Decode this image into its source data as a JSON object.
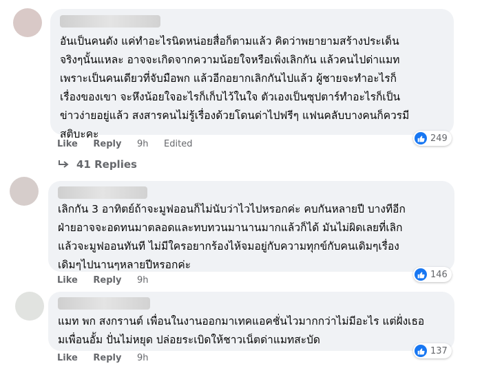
{
  "comments": [
    {
      "lines": [
        "อันเป็นคนดัง แค่ทำอะไรนิดหน่อยสื่อก็ตามแล้ว คิดว่าพยายามสร้างประเด็น",
        "จริงๆนั้นแหละ อาจจะเกิดจากความน้อยใจหรือเพิ่งเลิกกัน แล้วคนไปด่าแมท",
        "เพราะเป็นคนเดียวที่จับมือพก แล้วอีกอยากเลิกกันไปแล้ว ผู้ชายจะทำอะไรก็",
        "เรื่องของเขา จะหึงน้อยใจอะไรก็เก็บไว้ในใจ ตัวเองเป็นซุปตาร์ทำอะไรก็เป็น",
        "ข่าวง่ายอยู่แล้ว สงสารคนไม่รู้เรื่องด้วยโดนด่าไปฟรีๆ แฟนคลับบางคนก็ควรมี",
        "สติบะคะ"
      ],
      "like": "Like",
      "reply": "Reply",
      "time": "9h",
      "edited": "Edited",
      "reaction_count": "249",
      "replies_label": "41 Replies"
    },
    {
      "lines": [
        "เลิกกัน 3 อาทิตย์ถ้าจะมูฟออนก็ไม่นับว่าไวไปหรอกค่ะ คบกันหลายปี บางทีอีก",
        "ฝ่ายอาจจะอดทนมาตลอดและทบทวนมานานมากแล้วก็ได้ มันไม่ผิดเลยที่เลิก",
        "แล้วจะมูฟออนทันที ไม่มีใครอยากร้องไห้จมอยู่กับความทุกข์กับคนเดิมๆเรื่อง",
        "เดิมๆไปนานๆหลายปีหรอกค่ะ"
      ],
      "like": "Like",
      "reply": "Reply",
      "time": "9h",
      "reaction_count": "146"
    },
    {
      "lines": [
        "แมท พก สงกรานต์ เพื่อนในงานออกมาเทคแอคชั่นไวมากกว่าไม่มีอะไร แต่ฝั่งเธอ",
        "มเพื่อนอั้ม ปั่นไม่หยุด ปล่อยระเบิดให้ชาวเน็ตด่าแมทสะบัด"
      ],
      "like": "Like",
      "reply": "Reply",
      "time": "9h",
      "reaction_count": "137"
    }
  ],
  "colors": {
    "bubble": "#f0f2f5",
    "meta_text": "#65676b",
    "like_blue": "#1877f2"
  },
  "icons": [
    "like-reaction-icon",
    "reply-arrow-icon"
  ]
}
